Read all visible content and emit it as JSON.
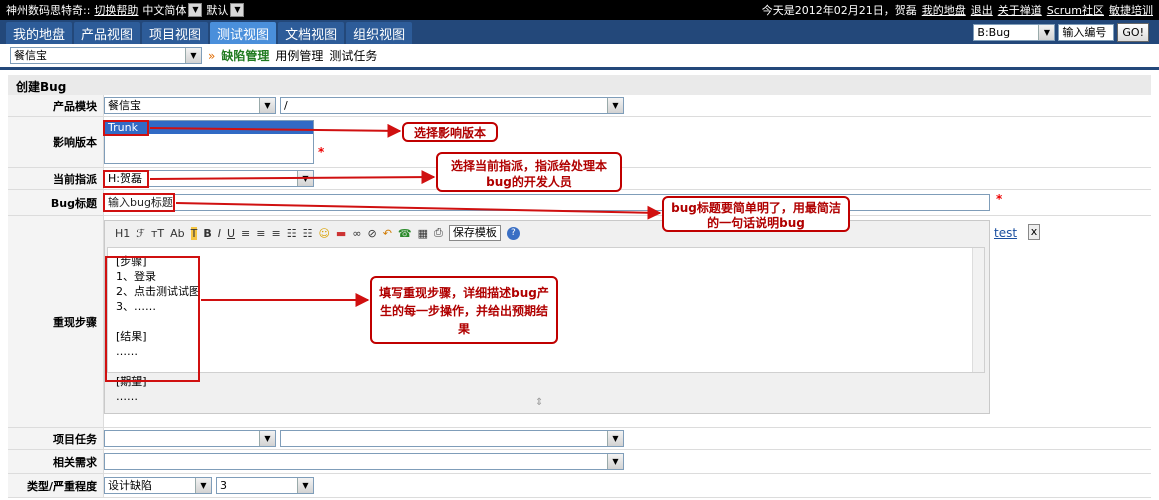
{
  "topbar": {
    "brand": "神州数码思特奇::",
    "switch_help": "切换帮助",
    "language": "中文简体",
    "theme": "默认",
    "greeting": "今天是2012年02月21日，贺磊",
    "links": [
      "我的地盘",
      "退出",
      "关于禅道",
      "Scrum社区",
      "敏捷培训"
    ]
  },
  "nav": {
    "tabs": [
      "我的地盘",
      "产品视图",
      "项目视图",
      "测试视图",
      "文档视图",
      "组织视图"
    ],
    "active_index": 3,
    "search_type": "B:Bug",
    "search_placeholder": "输入编号",
    "go": "GO!"
  },
  "subnav": {
    "product": "餐信宝",
    "separator": "»",
    "items": [
      "缺陷管理",
      "用例管理",
      "测试任务"
    ]
  },
  "form": {
    "title": "创建Bug",
    "product_module": {
      "label": "产品模块",
      "product": "餐信宝",
      "module": "/"
    },
    "affected_version": {
      "label": "影响版本",
      "option": "Trunk",
      "required": "*"
    },
    "assign": {
      "label": "当前指派",
      "value": "H:贺磊"
    },
    "title_field": {
      "label": "Bug标题",
      "placeholder": "输入bug标题",
      "required": "*"
    },
    "steps": {
      "label": "重现步骤",
      "toolbar": [
        "H1",
        "ℱ",
        "тT",
        "Ab",
        "T",
        "B",
        "I",
        "U",
        "≡",
        "≡",
        "≡",
        "☷",
        "☷",
        "☺",
        "▬",
        "∞",
        "⊘",
        "↶",
        "☎",
        "▦",
        "⎙"
      ],
      "save_template": "保存模板",
      "lines": [
        "[步骤]",
        "1、登录",
        "2、点击测试试图",
        "3、……",
        "",
        "[结果]",
        "……",
        "",
        "[期望]",
        "……"
      ],
      "side_link": "test",
      "side_close": "x"
    },
    "project_task": {
      "label": "项目任务"
    },
    "related_story": {
      "label": "相关需求"
    },
    "type_severity": {
      "label": "类型/严重程度",
      "type": "设计缺陷",
      "severity": "3"
    }
  },
  "annotations": [
    "选择影响版本",
    "选择当前指派，指派给处理本bug的开发人员",
    "bug标题要简单明了，用最简洁的一句话说明bug",
    "填写重现步骤，详细描述bug产生的每一步操作，并给出预期结果"
  ]
}
